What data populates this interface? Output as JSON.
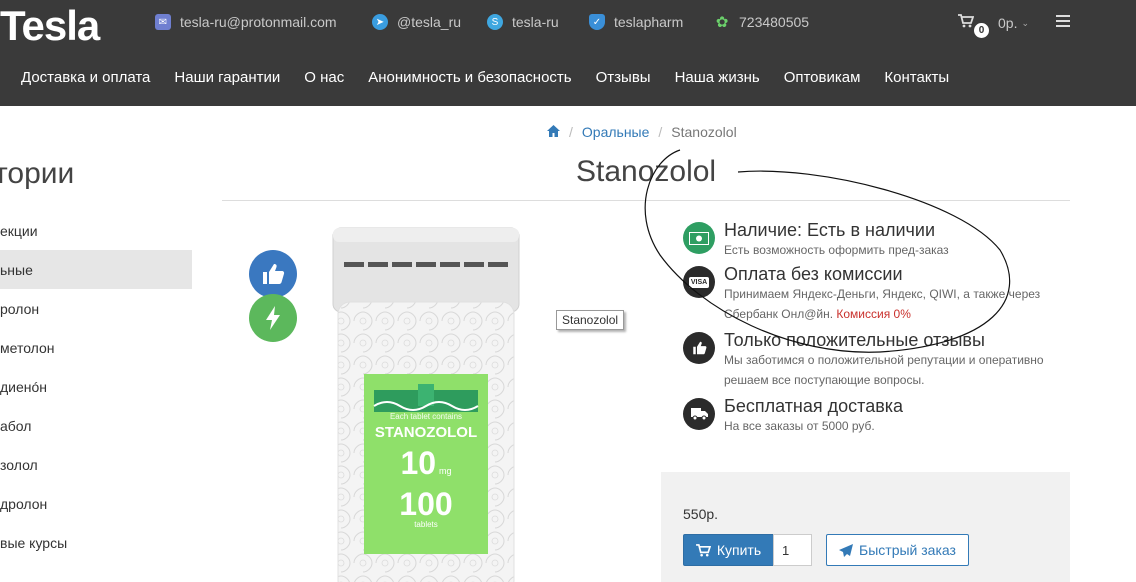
{
  "header": {
    "logo": "Tesla",
    "contacts": [
      {
        "icon": "mail-icon",
        "text": "tesla-ru@protonmail.com"
      },
      {
        "icon": "telegram-icon",
        "text": "@tesla_ru"
      },
      {
        "icon": "skype-icon",
        "text": "tesla-ru"
      },
      {
        "icon": "shield-icon",
        "text": "teslapharm"
      },
      {
        "icon": "icq-flower-icon",
        "text": "723480505"
      }
    ],
    "cart": {
      "count": "0",
      "sum": "0р."
    },
    "nav": [
      "Доставка и оплата",
      "Наши гарантии",
      "О нас",
      "Анонимность и безопасность",
      "Отзывы",
      "Наша жизнь",
      "Оптовикам",
      "Контакты"
    ]
  },
  "breadcrumb": {
    "link": "Оральные",
    "current": "Stanozolol"
  },
  "sidebar": {
    "title": "тории",
    "items": [
      "екции",
      "ьные",
      "ролон",
      "метолон",
      "диенóн",
      "абол",
      "золол",
      "дролон",
      "вые курсы"
    ]
  },
  "product": {
    "title": "Stanozolol",
    "tooltip": "Stanozolol",
    "label": {
      "line1": "Each tablet contains",
      "name": "STANOZOLOL",
      "dose": "10",
      "unit": "mg",
      "count": "100",
      "count_unit": "tablets"
    },
    "features": [
      {
        "icon": "money-icon",
        "color": "#2e9e62",
        "title": "Наличие: Есть в наличии",
        "desc": "Есть возможность оформить пред-заказ",
        "desc_red": ""
      },
      {
        "icon": "visa-card-icon",
        "color": "#2b2b2b",
        "title": "Оплата без комиссии",
        "desc": "Принимаем Яндекс-Деньги, Яндекс, QIWI, а также через Сбербанк Онл@йн.",
        "desc_red": "Комиссия 0%"
      },
      {
        "icon": "thumbs-up-icon",
        "color": "#2b2b2b",
        "title": "Только положительные отзывы",
        "desc": "Мы заботимся о положительной репутации и оперативно решаем все поступающие вопросы.",
        "desc_red": ""
      },
      {
        "icon": "truck-icon",
        "color": "#2b2b2b",
        "title": "Бесплатная доставка",
        "desc": "На все заказы от 5000 руб.",
        "desc_red": ""
      }
    ],
    "price": "550р.",
    "buy_label": "Купить",
    "quantity": "1",
    "quick_order_label": "Быстрый заказ"
  },
  "colors": {
    "header_bg": "#3a3a3a",
    "link": "#337ab7",
    "accent_green": "#5cb85c",
    "accent_blue": "#3a78c0",
    "red": "#c9302c"
  }
}
